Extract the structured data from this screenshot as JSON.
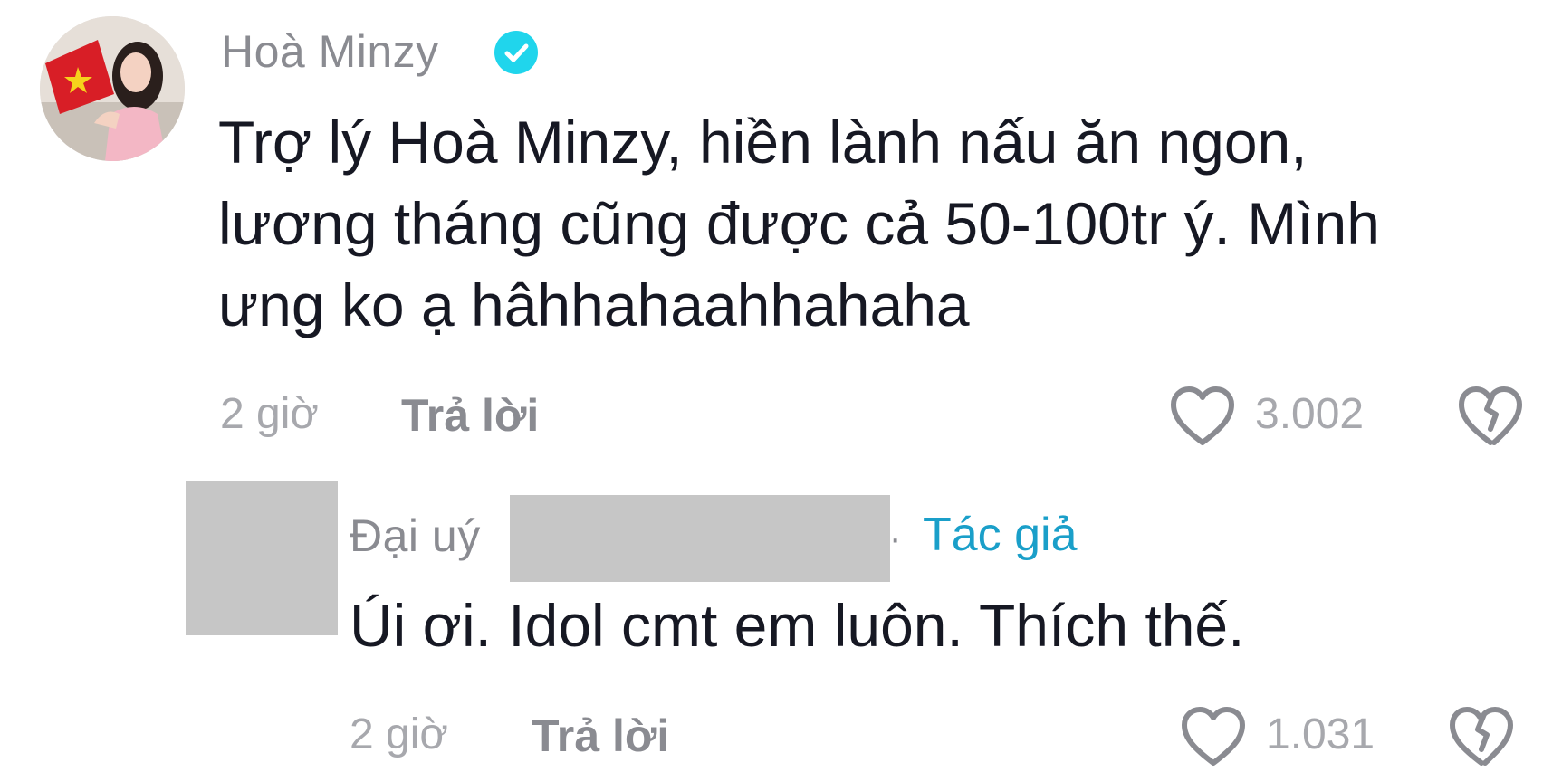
{
  "comment": {
    "username": "Hoà Minzy",
    "verified": true,
    "text_lines": [
      "Trợ lý Hoà Minzy, hiền lành nấu ăn ngon,",
      "lương tháng cũng được cả 50-100tr ý. Mình",
      "ưng ko ạ hâhhahaahhahaha"
    ],
    "time": "2 giờ",
    "reply_label": "Trả lời",
    "likes": "3.002",
    "icons": {
      "like": "heart-outline-icon",
      "dislike": "broken-heart-icon",
      "verified": "verified-check-icon"
    }
  },
  "reply": {
    "username_prefix": "Đại uý",
    "separator": "·",
    "author_tag": "Tác giả",
    "text": "Úi ơi. Idol cmt em luôn. Thích thế.",
    "time": "2 giờ",
    "reply_label": "Trả lời",
    "likes": "1.031"
  },
  "colors": {
    "text_primary": "#161823",
    "text_secondary": "#8a8b91",
    "meta_gray": "#a7a8ad",
    "author_tag_blue": "#1a9fc9",
    "verified_cyan": "#20d5ec",
    "redaction_gray": "#c6c6c6"
  }
}
